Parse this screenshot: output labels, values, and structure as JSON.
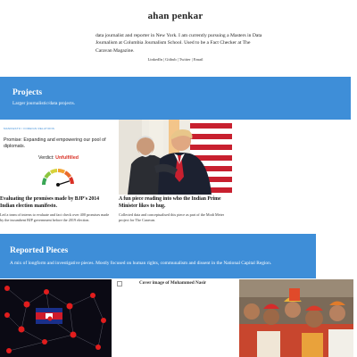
{
  "header": {
    "site_title": "ahan penkar",
    "bio": "data journalist and reporter in New York. I am currently pursuing a Masters in Data Journalism at Columbia Journalism School. Used to be a Fact Checker at The Caravan Magazine.",
    "links": [
      "LinkedIn",
      "Github",
      "Twitter",
      "Email"
    ],
    "link_separator": "|"
  },
  "projects": {
    "title": "Projects",
    "subtitle": "Larger journalistic/data projects.",
    "cards": [
      {
        "thumb_tags": "MANIFESTO  /  FOREIGN RELATIONS",
        "thumb_headline": "Promise: Expanding and empowering our pool of diplomats.",
        "thumb_verdict_label": "Verdict:",
        "thumb_verdict_value": "Unfulfilled",
        "title": "Evaluating the promises made by BJP's 2014 Indian election manifesto.",
        "description": "Led a team of interns to evaluate and fact check over 400 promises made by the incumbent BJP government before the 2019 election."
      },
      {
        "title": "A fun piece reading into who the Indian Prime Minister likes to hug.",
        "description": "Collected data and conceptualised this piece as part of the Modi Meter project for The Caravan."
      }
    ]
  },
  "reported": {
    "title": "Reported Pieces",
    "subtitle": "A mix of longform and investigative pieces. Mostly focused on human rights, communalism and dissent in the National Capital Region.",
    "images": [
      {
        "kind": "network-map-photo"
      },
      {
        "kind": "broken-image",
        "alt": "Cover image of Mohammed Nasir"
      },
      {
        "kind": "crowd-photo"
      }
    ]
  },
  "colors": {
    "band": "#3e8ed8",
    "verdict": "#d93025"
  },
  "gauge": {
    "segments": 6,
    "needle_level": 0.9
  }
}
